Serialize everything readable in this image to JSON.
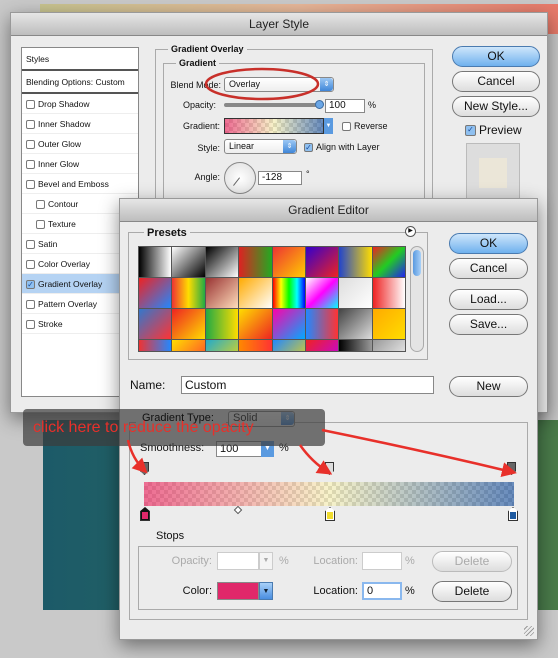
{
  "layer_style": {
    "title": "Layer Style",
    "styles_header": "Styles",
    "blending": "Blending Options: Custom",
    "items": [
      {
        "label": "Drop Shadow",
        "checked": false
      },
      {
        "label": "Inner Shadow",
        "checked": false
      },
      {
        "label": "Outer Glow",
        "checked": false
      },
      {
        "label": "Inner Glow",
        "checked": false
      },
      {
        "label": "Bevel and Emboss",
        "checked": false
      },
      {
        "label": "Contour",
        "checked": false
      },
      {
        "label": "Texture",
        "checked": false
      },
      {
        "label": "Satin",
        "checked": false
      },
      {
        "label": "Color Overlay",
        "checked": false
      },
      {
        "label": "Gradient Overlay",
        "checked": true
      },
      {
        "label": "Pattern Overlay",
        "checked": false
      },
      {
        "label": "Stroke",
        "checked": false
      }
    ],
    "section": "Gradient Overlay",
    "subsection": "Gradient",
    "blend_mode_label": "Blend Mode:",
    "blend_mode": "Overlay",
    "opacity_label": "Opacity:",
    "opacity": "100",
    "opacity_fraction": 1.0,
    "percent": "%",
    "gradient_label": "Gradient:",
    "reverse_label": "Reverse",
    "reverse": false,
    "style_label": "Style:",
    "style": "Linear",
    "align_label": "Align with Layer",
    "align": true,
    "angle_label": "Angle:",
    "angle": "-128",
    "degree": "°",
    "ok": "OK",
    "cancel": "Cancel",
    "new_style": "New Style...",
    "preview_label": "Preview",
    "preview": true
  },
  "gradient_editor": {
    "title": "Gradient Editor",
    "presets_label": "Presets",
    "ok": "OK",
    "cancel": "Cancel",
    "load": "Load...",
    "save": "Save...",
    "name_label": "Name:",
    "name": "Custom",
    "new": "New",
    "type_label": "Gradient Type:",
    "type": "Solid",
    "smoothness_label": "Smoothness:",
    "smoothness": "100",
    "percent": "%",
    "stops_label": "Stops",
    "opacity_label": "Opacity:",
    "opacity": "",
    "location_label": "Location:",
    "opacity_location": "",
    "delete": "Delete",
    "color_label": "Color:",
    "color": "#e0286a",
    "color_location": "0",
    "color_stops": [
      "#e0286a",
      "#f0dc30",
      "#1e5aa0"
    ]
  },
  "annotation": {
    "text": "click here to reduce the opacity",
    "color": "#e8302a"
  }
}
